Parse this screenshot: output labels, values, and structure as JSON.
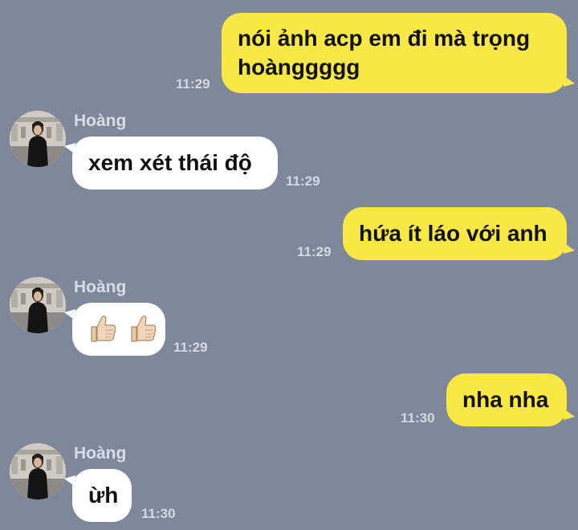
{
  "messages": [
    {
      "type": "sent",
      "text_line1": "nói ảnh acp em đi mà trọng",
      "text_line2": "hoànggggg",
      "time": "11:29"
    },
    {
      "type": "received",
      "sender": "Hoàng",
      "text": "xem xét thái độ",
      "time": "11:29"
    },
    {
      "type": "sent",
      "text": "hứa ít láo với anh",
      "time": "11:29"
    },
    {
      "type": "received",
      "sender": "Hoàng",
      "emoji": [
        "thumbs-up-icon",
        "thumbs-up-icon"
      ],
      "time": "11:29"
    },
    {
      "type": "sent",
      "text": "nha nha",
      "time": "11:30"
    },
    {
      "type": "received",
      "sender": "Hoàng",
      "text": "ừh",
      "time": "11:30"
    }
  ],
  "colors": {
    "background": "#7f879a",
    "sent_bubble": "#f7e845",
    "received_bubble": "#ffffff"
  }
}
